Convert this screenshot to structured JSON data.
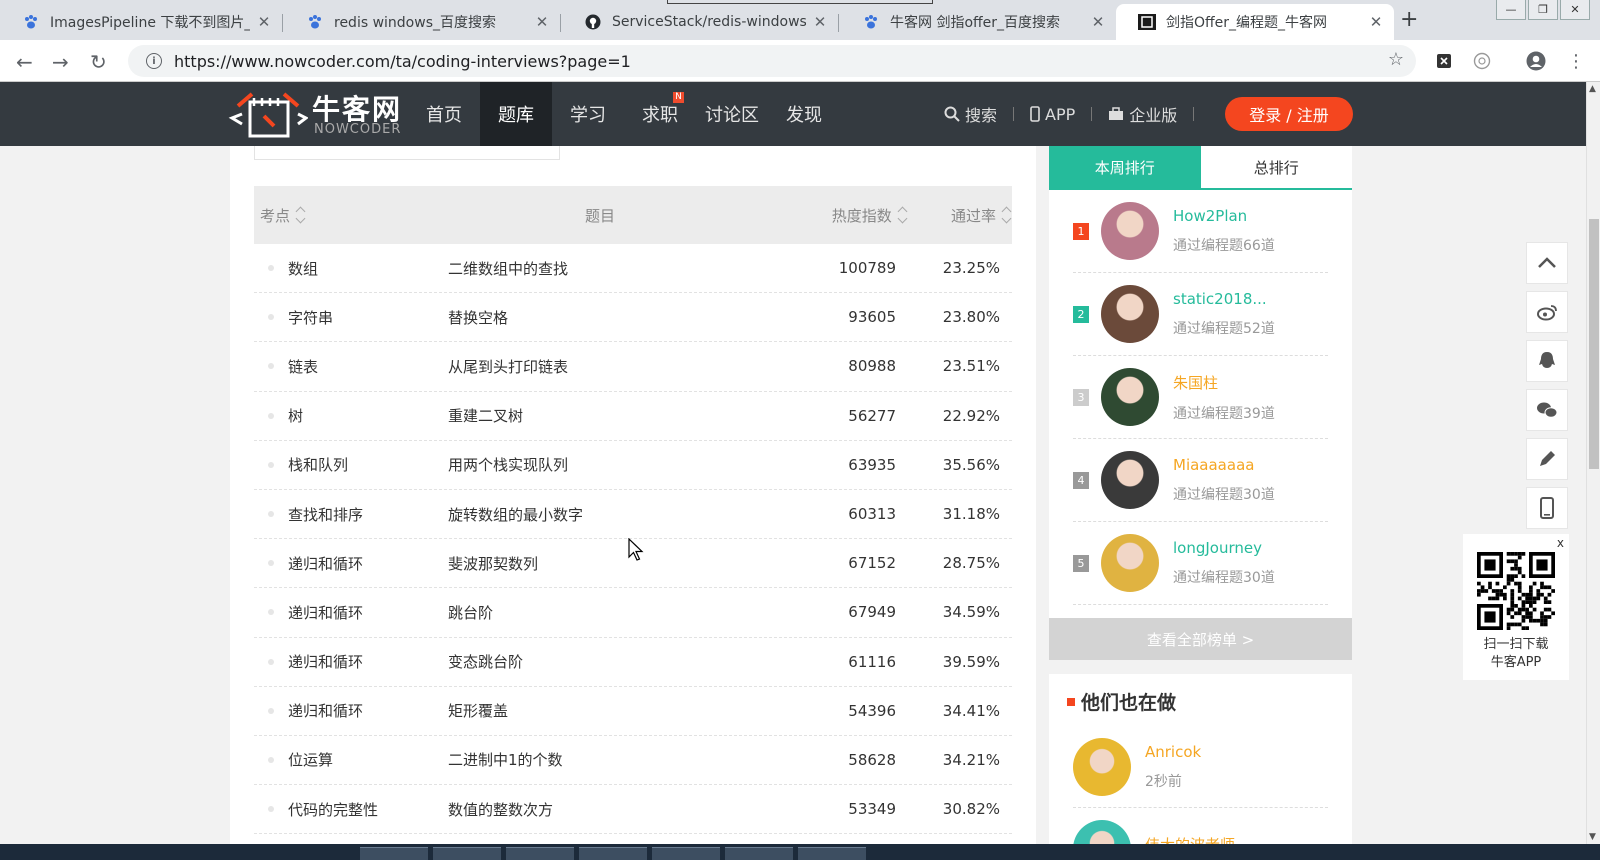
{
  "browser": {
    "tabs": [
      {
        "title": "ImagesPipeline 下载不到图片_",
        "icon": "baidu-paw-icon",
        "active": false
      },
      {
        "title": "redis windows_百度搜索",
        "icon": "baidu-paw-icon",
        "active": false
      },
      {
        "title": "ServiceStack/redis-windows: ",
        "icon": "github-icon",
        "active": false
      },
      {
        "title": "牛客网 剑指offer_百度搜索",
        "icon": "baidu-paw-icon",
        "active": false
      },
      {
        "title": "剑指Offer_编程题_牛客网",
        "icon": "nowcoder-icon",
        "active": true
      }
    ],
    "url": "https://www.nowcoder.com/ta/coding-interviews?page=1"
  },
  "site": {
    "logo_cn": "牛客网",
    "logo_en": "NOWCODER",
    "nav": [
      {
        "label": "首页",
        "active": false,
        "badge": ""
      },
      {
        "label": "题库",
        "active": true,
        "badge": ""
      },
      {
        "label": "学习",
        "active": false,
        "badge": ""
      },
      {
        "label": "求职",
        "active": false,
        "badge": "N"
      },
      {
        "label": "讨论区",
        "active": false,
        "badge": ""
      },
      {
        "label": "发现",
        "active": false,
        "badge": ""
      }
    ],
    "search_label": "搜索",
    "app_label": "APP",
    "enterprise_label": "企业版",
    "login_label": "登录 / 注册",
    "accent": "#25bb9b",
    "brand_orange": "#f4461f"
  },
  "table": {
    "headers": {
      "point": "考点",
      "title": "题目",
      "heat": "热度指数",
      "rate": "通过率"
    },
    "rows": [
      {
        "point": "数组",
        "title": "二维数组中的查找",
        "heat": "100789",
        "rate": "23.25%"
      },
      {
        "point": "字符串",
        "title": "替换空格",
        "heat": "93605",
        "rate": "23.80%"
      },
      {
        "point": "链表",
        "title": "从尾到头打印链表",
        "heat": "80988",
        "rate": "23.51%"
      },
      {
        "point": "树",
        "title": "重建二叉树",
        "heat": "56277",
        "rate": "22.92%"
      },
      {
        "point": "栈和队列",
        "title": "用两个栈实现队列",
        "heat": "63935",
        "rate": "35.56%"
      },
      {
        "point": "查找和排序",
        "title": "旋转数组的最小数字",
        "heat": "60313",
        "rate": "31.18%"
      },
      {
        "point": "递归和循环",
        "title": "斐波那契数列",
        "heat": "67152",
        "rate": "28.75%"
      },
      {
        "point": "递归和循环",
        "title": "跳台阶",
        "heat": "67949",
        "rate": "34.59%"
      },
      {
        "point": "递归和循环",
        "title": "变态跳台阶",
        "heat": "61116",
        "rate": "39.59%"
      },
      {
        "point": "递归和循环",
        "title": "矩形覆盖",
        "heat": "54396",
        "rate": "34.41%"
      },
      {
        "point": "位运算",
        "title": "二进制中1的个数",
        "heat": "58628",
        "rate": "34.21%"
      },
      {
        "point": "代码的完整性",
        "title": "数值的整数次方",
        "heat": "53349",
        "rate": "30.82%"
      }
    ]
  },
  "ranking": {
    "tab_week": "本周排行",
    "tab_total": "总排行",
    "items": [
      {
        "rank": "1",
        "name": "How2Plan",
        "sub": "通过编程题66道",
        "rank_color": "#f4461f",
        "name_color": "#25bb9b",
        "avatar_color": "#b97a8c"
      },
      {
        "rank": "2",
        "name": "static2018...",
        "sub": "通过编程题52道",
        "rank_color": "#25bb9b",
        "name_color": "#25bb9b",
        "avatar_color": "#6b4a3a"
      },
      {
        "rank": "3",
        "name": "朱国柱",
        "sub": "通过编程题39道",
        "rank_color": "#cccccc",
        "name_color": "#f5a623",
        "avatar_color": "#2f4a32"
      },
      {
        "rank": "4",
        "name": "Miaaaaaaa",
        "sub": "通过编程题30道",
        "rank_color": "#999999",
        "name_color": "#f5a623",
        "avatar_color": "#3a3a3a"
      },
      {
        "rank": "5",
        "name": "longJourney",
        "sub": "通过编程题30道",
        "rank_color": "#999999",
        "name_color": "#25bb9b",
        "avatar_color": "#e0b341"
      }
    ],
    "more_label": "查看全部榜单 >"
  },
  "doing": {
    "title": "他们也在做",
    "items": [
      {
        "name": "Anricok",
        "sub": "2秒前",
        "avatar_color": "#e8b830"
      },
      {
        "name": "伟大的波老师",
        "sub": "",
        "avatar_color": "#3cc0b0"
      }
    ]
  },
  "qr": {
    "line1": "扫一扫下载",
    "line2": "牛客APP",
    "close": "x"
  }
}
